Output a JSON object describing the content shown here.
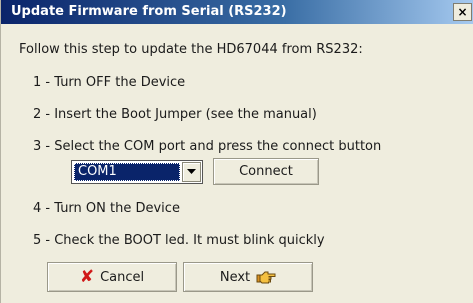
{
  "window": {
    "title": "Update Firmware from Serial (RS232)",
    "close_glyph": "×"
  },
  "content": {
    "intro": "Follow this step to update the HD67044 from RS232:",
    "steps": [
      "1 - Turn OFF the Device",
      "2 - Insert the Boot Jumper (see the manual)",
      "3 - Select the  COM port and press the connect button",
      "4 - Turn ON the Device",
      "5 - Check the BOOT led. It must blink quickly"
    ]
  },
  "com_port": {
    "selected": "COM1"
  },
  "buttons": {
    "connect_label": "Connect",
    "cancel_label": "Cancel",
    "cancel_icon": "red-x-icon",
    "next_label": "Next",
    "next_icon": "pointing-hand-icon"
  },
  "colors": {
    "title_bar": "#0a246a",
    "selection": "#0a246a",
    "cancel_icon": "#d01818",
    "next_icon": "#d8a020"
  }
}
